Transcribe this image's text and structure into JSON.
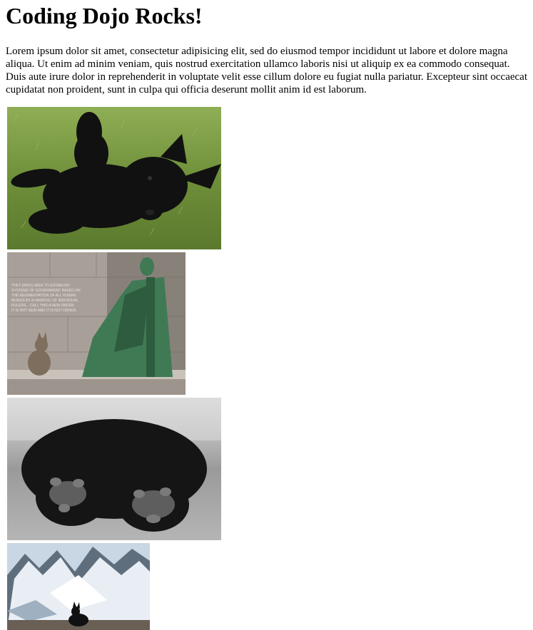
{
  "page": {
    "heading": "Coding Dojo Rocks!",
    "paragraph": "Lorem ipsum dolor sit amet, consectetur adipisicing elit, sed do eiusmod tempor incididunt ut labore et dolore magna aliqua. Ut enim ad minim veniam, quis nostrud exercitation ullamco laboris nisi ut aliquip ex ea commodo consequat. Duis aute irure dolor in reprehenderit in voluptate velit esse cillum dolore eu fugiat nulla pariatur. Excepteur sint occaecat cupidatat non proident, sunt in culpa qui officia deserunt mollit anim id est laborum."
  },
  "images": {
    "statue_inscription": [
      "THEY (WHO) SEEK TO ESTABLISH",
      "SYSTEMS OF GOVERNMENT BASED ON",
      "THE REGIMENTATION OF ALL HUMAN",
      "BEINGS BY A HANDFUL OF INDIVIDUAL",
      "RULERS... CALL THIS A NEW ORDER.",
      "IT IS NOT NEW AND IT IS NOT ORDER."
    ]
  },
  "colors": {
    "grass": "#6f8f3a",
    "fur": "#111111",
    "bronze": "#3f7a55",
    "granite": "#a89f98",
    "snow": "#e8eef4",
    "sky": "#c9d6e3"
  }
}
